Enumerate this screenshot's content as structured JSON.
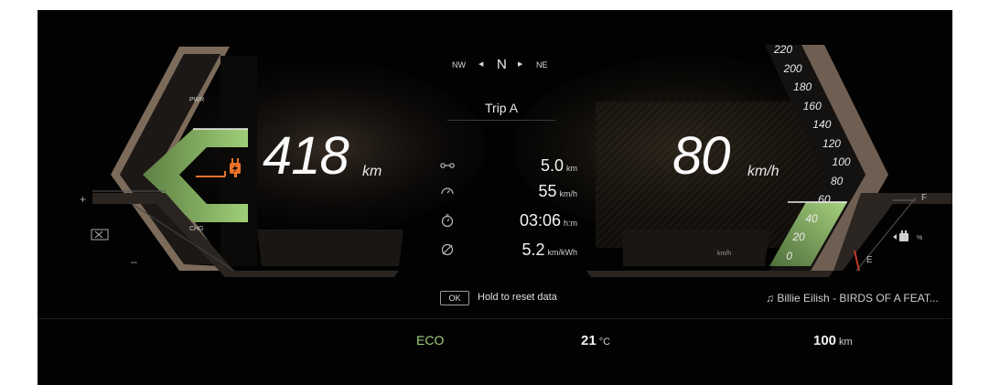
{
  "compass": {
    "left": "NW",
    "heading": "N",
    "right": "NE",
    "left_arrow": "◀",
    "right_arrow": "▶"
  },
  "trip": {
    "title": "Trip A",
    "rows": [
      {
        "icon": "distance-icon",
        "value": "5.0",
        "unit": "km"
      },
      {
        "icon": "speedometer-icon",
        "value": "55",
        "unit": "km/h"
      },
      {
        "icon": "stopwatch-icon",
        "value": "03:06",
        "unit": "h:m"
      },
      {
        "icon": "average-icon",
        "value": "5.2",
        "unit": "km/kWh"
      }
    ],
    "ok_label": "OK",
    "reset_text": "Hold to reset data"
  },
  "range": {
    "value": "418",
    "unit": "km"
  },
  "power_gauge": {
    "top_label": "PWR",
    "bottom_label": "CHG",
    "plus": "+",
    "minus": "–",
    "level_fraction": 0.35
  },
  "speed": {
    "value": "80",
    "unit": "km/h",
    "small_unit": "km/h",
    "max": 220,
    "ticks": [
      220,
      200,
      180,
      160,
      140,
      120,
      100,
      80,
      60,
      40,
      20,
      0
    ]
  },
  "battery": {
    "full": "F",
    "empty": "E",
    "unit": "%",
    "level_fraction": 0.0
  },
  "media": {
    "note_icon": "♫",
    "track": "Billie Eilish - BIRDS OF A FEAT..."
  },
  "status": {
    "mode": "ECO",
    "temp_value": "21",
    "temp_unit": "°C",
    "odo_value": "100",
    "odo_unit": "km"
  },
  "colors": {
    "accent_green": "#8fbf6a",
    "charge_orange": "#e8732a",
    "gauge_bronze": "#8a7563",
    "mode_green": "#9fd07a"
  }
}
